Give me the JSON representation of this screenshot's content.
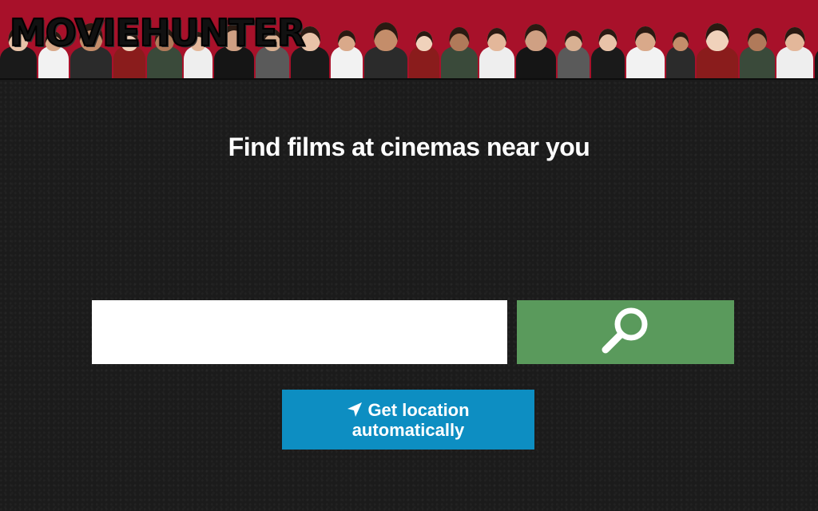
{
  "header": {
    "logo_text": "MOVIEHUNTER",
    "banner_color": "#a8112a"
  },
  "main": {
    "headline": "Find films at cinemas near you",
    "search": {
      "value": "",
      "placeholder": "",
      "button_icon": "search-icon",
      "button_color": "#5a9a5c"
    },
    "location_button": {
      "label_line1": "Get location",
      "label_line2": "automatically",
      "icon": "location-arrow-icon",
      "color": "#0d8ec2"
    }
  }
}
